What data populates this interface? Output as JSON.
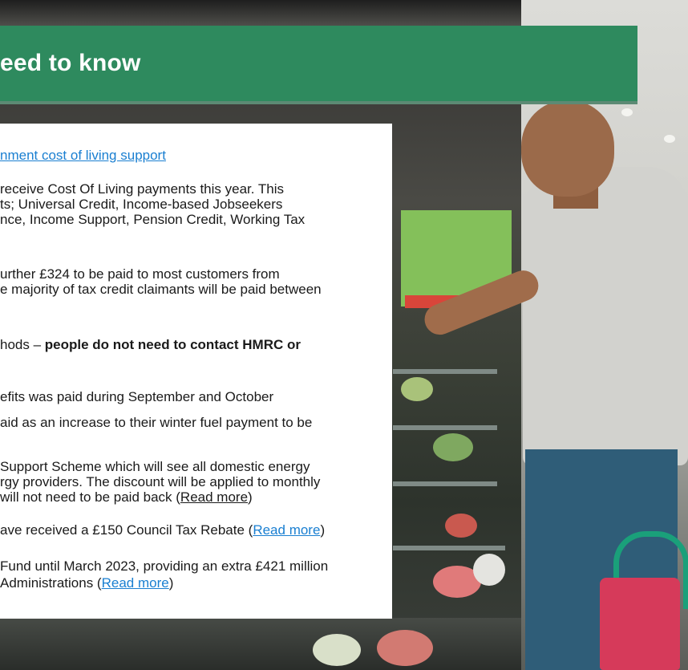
{
  "banner": {
    "title": "eed to know",
    "color": "#2e8a5e"
  },
  "card": {
    "link_title": "nment cost of living support",
    "para1": [
      "receive Cost Of Living payments this year. This",
      "ts; Universal Credit, Income-based Jobseekers",
      "nce, Income Support, Pension Credit, Working Tax"
    ],
    "para2": [
      "urther £324 to be paid to most customers from",
      "e majority of tax credit claimants will be paid between"
    ],
    "para3_prefix": "hods – ",
    "para3_bold_1": "people do not need to contact HMRC or",
    "para4": "efits was paid during September and October",
    "para5": "aid as an increase to their winter fuel payment to be",
    "para6": [
      "Support Scheme which will see all domestic energy",
      "rgy providers. The discount will be applied to monthly"
    ],
    "para6_line3_text": " will not need to be paid back (",
    "para6_link": "Read more",
    "para6_close": ")",
    "para7_text": "ave received a £150 Council Tax Rebate (",
    "para7_link": "Read more",
    "para7_close": ")",
    "para8_line1": "Fund until March 2023, providing an extra £421 million",
    "para8_line2_text": "Administrations (",
    "para8_link": "Read more",
    "para8_close": ")",
    "link_color": "#1a7fd1"
  }
}
